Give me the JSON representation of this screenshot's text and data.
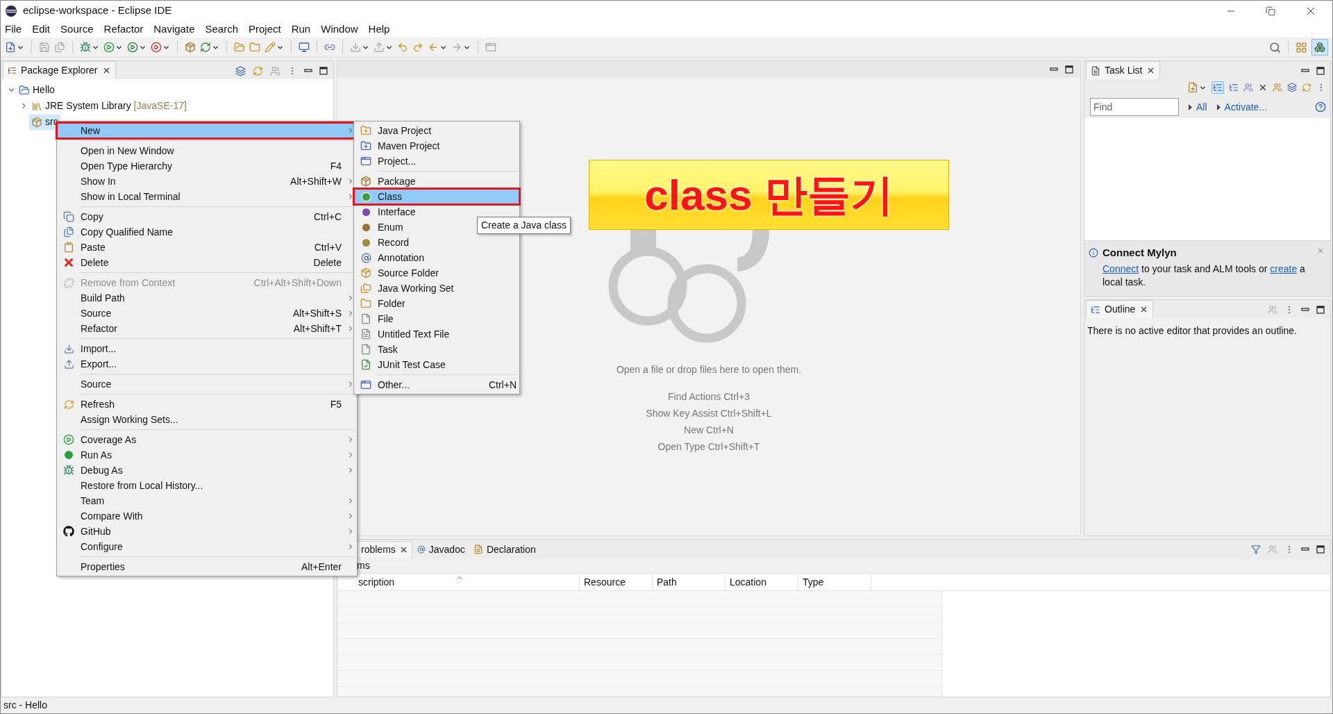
{
  "window": {
    "title": "eclipse-workspace - Eclipse IDE"
  },
  "menu_bar": [
    "File",
    "Edit",
    "Source",
    "Refactor",
    "Navigate",
    "Search",
    "Project",
    "Run",
    "Window",
    "Help"
  ],
  "package_explorer": {
    "title": "Package Explorer",
    "tree": [
      {
        "label": "Hello",
        "expanded": true,
        "selected": false,
        "children": [
          {
            "label": "JRE System Library",
            "decoration": "[JavaSE-17]",
            "expanded": false,
            "selected": false
          },
          {
            "label": "src",
            "selected": true
          }
        ]
      }
    ]
  },
  "context_menu": {
    "groups": [
      [
        {
          "label": "New",
          "submenu": true,
          "selected": true,
          "disabled": false,
          "marked": true
        }
      ],
      [
        {
          "label": "Open in New Window",
          "submenu": false,
          "selected": false,
          "disabled": false,
          "marked": false
        },
        {
          "label": "Open Type Hierarchy",
          "shortcut": "F4",
          "submenu": false,
          "selected": false,
          "disabled": false,
          "marked": false
        },
        {
          "label": "Show In",
          "shortcut": "Alt+Shift+W",
          "submenu": true,
          "selected": false,
          "disabled": false,
          "marked": false
        },
        {
          "label": "Show in Local Terminal",
          "submenu": true,
          "selected": false,
          "disabled": false,
          "marked": false
        }
      ],
      [
        {
          "label": "Copy",
          "shortcut": "Ctrl+C",
          "submenu": false,
          "selected": false,
          "disabled": false,
          "marked": false
        },
        {
          "label": "Copy Qualified Name",
          "submenu": false,
          "selected": false,
          "disabled": false,
          "marked": false
        },
        {
          "label": "Paste",
          "shortcut": "Ctrl+V",
          "submenu": false,
          "selected": false,
          "disabled": false,
          "marked": false
        },
        {
          "label": "Delete",
          "shortcut": "Delete",
          "submenu": false,
          "selected": false,
          "disabled": false,
          "marked": false
        }
      ],
      [
        {
          "label": "Remove from Context",
          "shortcut": "Ctrl+Alt+Shift+Down",
          "submenu": false,
          "selected": false,
          "disabled": true,
          "marked": false
        },
        {
          "label": "Build Path",
          "submenu": true,
          "selected": false,
          "disabled": false,
          "marked": false
        },
        {
          "label": "Source",
          "shortcut": "Alt+Shift+S",
          "submenu": true,
          "selected": false,
          "disabled": false,
          "marked": false
        },
        {
          "label": "Refactor",
          "shortcut": "Alt+Shift+T",
          "submenu": true,
          "selected": false,
          "disabled": false,
          "marked": false
        }
      ],
      [
        {
          "label": "Import...",
          "submenu": false,
          "selected": false,
          "disabled": false,
          "marked": false
        },
        {
          "label": "Export...",
          "submenu": false,
          "selected": false,
          "disabled": false,
          "marked": false
        }
      ],
      [
        {
          "label": "Source",
          "submenu": true,
          "selected": false,
          "disabled": false,
          "marked": false
        }
      ],
      [
        {
          "label": "Refresh",
          "shortcut": "F5",
          "submenu": false,
          "selected": false,
          "disabled": false,
          "marked": false
        },
        {
          "label": "Assign Working Sets...",
          "submenu": false,
          "selected": false,
          "disabled": false,
          "marked": false
        }
      ],
      [
        {
          "label": "Coverage As",
          "submenu": true,
          "selected": false,
          "disabled": false,
          "marked": false
        },
        {
          "label": "Run As",
          "submenu": true,
          "selected": false,
          "disabled": false,
          "marked": false
        },
        {
          "label": "Debug As",
          "submenu": true,
          "selected": false,
          "disabled": false,
          "marked": false
        },
        {
          "label": "Restore from Local History...",
          "submenu": false,
          "selected": false,
          "disabled": false,
          "marked": false
        },
        {
          "label": "Team",
          "submenu": true,
          "selected": false,
          "disabled": false,
          "marked": false
        },
        {
          "label": "Compare With",
          "submenu": true,
          "selected": false,
          "disabled": false,
          "marked": false
        },
        {
          "label": "GitHub",
          "submenu": true,
          "selected": false,
          "disabled": false,
          "marked": false
        },
        {
          "label": "Configure",
          "submenu": true,
          "selected": false,
          "disabled": false,
          "marked": false
        }
      ],
      [
        {
          "label": "Properties",
          "shortcut": "Alt+Enter",
          "submenu": false,
          "selected": false,
          "disabled": false,
          "marked": false
        }
      ]
    ]
  },
  "submenu": {
    "groups": [
      [
        {
          "label": "Java Project",
          "selected": false,
          "marked": false
        },
        {
          "label": "Maven Project",
          "selected": false,
          "marked": false
        },
        {
          "label": "Project...",
          "selected": false,
          "marked": false
        }
      ],
      [
        {
          "label": "Package",
          "selected": false,
          "marked": false
        },
        {
          "label": "Class",
          "selected": true,
          "marked": true
        },
        {
          "label": "Interface",
          "selected": false,
          "marked": false
        },
        {
          "label": "Enum",
          "selected": false,
          "marked": false
        },
        {
          "label": "Record",
          "selected": false,
          "marked": false
        },
        {
          "label": "Annotation",
          "selected": false,
          "marked": false
        },
        {
          "label": "Source Folder",
          "selected": false,
          "marked": false
        },
        {
          "label": "Java Working Set",
          "selected": false,
          "marked": false
        },
        {
          "label": "Folder",
          "selected": false,
          "marked": false
        },
        {
          "label": "File",
          "selected": false,
          "marked": false
        },
        {
          "label": "Untitled Text File",
          "selected": false,
          "marked": false
        },
        {
          "label": "Task",
          "selected": false,
          "marked": false
        },
        {
          "label": "JUnit Test Case",
          "selected": false,
          "marked": false
        }
      ],
      [
        {
          "label": "Other...",
          "shortcut": "Ctrl+N",
          "selected": false,
          "marked": false
        }
      ]
    ]
  },
  "tooltip": "Create a Java class",
  "banner": "class 만들기",
  "editor": {
    "hints": [
      "Open a file or drop files here to open them.",
      "Find Actions Ctrl+3",
      "Show Key Assist Ctrl+Shift+L",
      "New Ctrl+N",
      "Open Type Ctrl+Shift+T"
    ]
  },
  "task_list": {
    "title": "Task List",
    "find": {
      "placeholder": "Find"
    },
    "links": [
      "All",
      "Activate..."
    ]
  },
  "mylyn": {
    "title": "Connect Mylyn",
    "parts": [
      {
        "text": "Connect",
        "link": true
      },
      {
        "text": " to your task and ALM tools or ",
        "link": false
      },
      {
        "text": "create",
        "link": true
      },
      {
        "text": " a local task.",
        "link": false
      }
    ]
  },
  "outline": {
    "title": "Outline",
    "message": "There is no active editor that provides an outline."
  },
  "problems": {
    "tabs": [
      {
        "label": "roblems",
        "selected": true
      },
      {
        "label": "Javadoc",
        "selected": false
      },
      {
        "label": "Declaration",
        "selected": false
      }
    ],
    "summary": "ms",
    "columns": [
      "scription",
      "Resource",
      "Path",
      "Location",
      "Type"
    ]
  },
  "status_bar": "src - Hello"
}
